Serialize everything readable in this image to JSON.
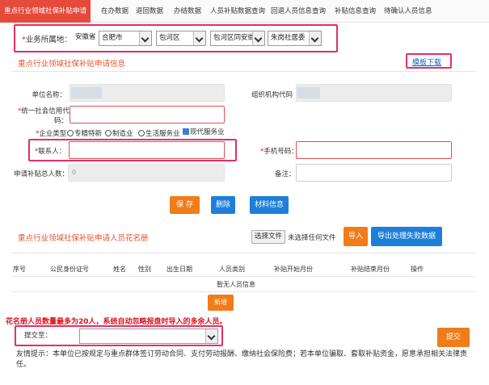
{
  "tabs": [
    {
      "label": "重点行业领域社保补贴申请",
      "active": true
    },
    {
      "label": "在办数据"
    },
    {
      "label": "退回数据"
    },
    {
      "label": "办结数据"
    },
    {
      "label": "人员补贴数据查询"
    },
    {
      "label": "回退人员信息查询"
    },
    {
      "label": "补贴信息查询"
    },
    {
      "label": "待确认人员信息"
    }
  ],
  "location": {
    "label": "业务所属地：",
    "selects": [
      "安徽省",
      "合肥市",
      "包河区",
      "包河区同安街",
      "朱岗社居委"
    ]
  },
  "apply_section": {
    "title": "重点行业领域社保补贴申请信息",
    "template_link": "模板下载"
  },
  "form": {
    "unit_name_label": "单位名称：",
    "org_code_label": "组织机构代码",
    "credit_code_label_1": "统一社会信用代",
    "credit_code_label_2": "码：",
    "enterprise_type_label": "企业类型：",
    "enterprise_types": [
      "专精特新",
      "制造业",
      "生活服务业",
      "现代服务业"
    ],
    "contact_label": "联系人：",
    "phone_label": "手机号码：",
    "total_people_label": "申请补贴总人数：",
    "total_people_value": "0",
    "remark_label": "备注："
  },
  "actions": {
    "save": "保 存",
    "delete": "删除",
    "materials": "材料信息"
  },
  "roster": {
    "title": "重点行业领域社保补贴申请人员花名册",
    "choose_file": "选择文件",
    "no_file": "未选择任何文件",
    "import": "导入",
    "export_failed": "导出处理失败数据",
    "columns": [
      "序号",
      "公民身份证号",
      "姓名",
      "性别",
      "出生日期",
      "人员类别",
      "补贴开始月份",
      "补贴结束月份",
      "操作"
    ],
    "empty_text": "暂无人员信息",
    "add": "新增"
  },
  "warning": "花名册人员数量最多为20人，系统自动忽略报盘时导入的多余人员。",
  "submit": {
    "label": "提交至：",
    "button": "提交"
  },
  "tip": "友情提示：本单位已按规定与重点群体签订劳动合同、支付劳动报酬、缴纳社会保险费；若本单位骗取、套取补贴资金，愿意承担相关法律责任。",
  "colors": {
    "accent_red": "#e64a3b",
    "highlight_border": "#e0306a",
    "orange": "#f07c1a",
    "blue": "#1d7fd8"
  }
}
